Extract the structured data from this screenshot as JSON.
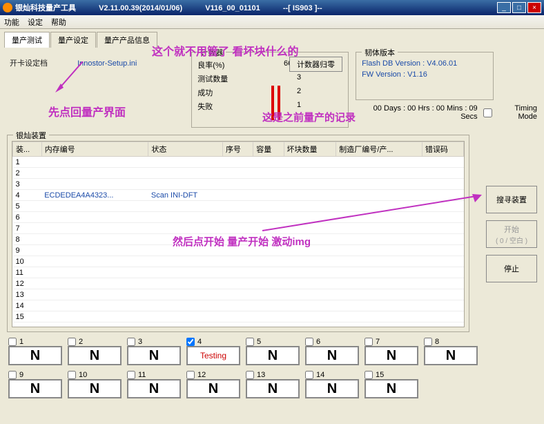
{
  "window": {
    "title1": "银灿科技量产工具",
    "title2": "V2.11.00.39(2014/01/06)",
    "title3": "V116_00_01101",
    "title4": "--[ IS903 ]--"
  },
  "menu": {
    "func": "功能",
    "settings": "设定",
    "help": "帮助"
  },
  "tabs": {
    "t1": "量产测试",
    "t2": "量产设定",
    "t3": "量产产品信息"
  },
  "opencard": {
    "label": "开卡设定档",
    "file": "Innostor-Setup.ini"
  },
  "counter": {
    "title": "计数器",
    "reset": "计数器归零",
    "rows": [
      {
        "label": "良率(%)",
        "value": "66 %"
      },
      {
        "label": "测试数量",
        "value": "3"
      },
      {
        "label": "成功",
        "value": "2"
      },
      {
        "label": "失败",
        "value": "1"
      }
    ]
  },
  "fw": {
    "title": "韧体版本",
    "db": "Flash DB Version :  V4.06.01",
    "ver": "FW Version :  V1.16"
  },
  "timing": {
    "elapsed": "00 Days : 00 Hrs : 00 Mins : 09 Secs",
    "label": "Timing Mode"
  },
  "table": {
    "group_title": "银灿装置",
    "headers": [
      "装...",
      "内存编号",
      "状态",
      "序号",
      "容量",
      "坏块数量",
      "制造厂编号/产...",
      "错误码"
    ],
    "rows": [
      {
        "n": "1"
      },
      {
        "n": "2"
      },
      {
        "n": "3"
      },
      {
        "n": "4",
        "mem": "ECDEDEA4A4323...",
        "status": "Scan INI-DFT"
      },
      {
        "n": "5"
      },
      {
        "n": "6"
      },
      {
        "n": "7"
      },
      {
        "n": "8"
      },
      {
        "n": "9"
      },
      {
        "n": "10"
      },
      {
        "n": "11"
      },
      {
        "n": "12"
      },
      {
        "n": "13"
      },
      {
        "n": "14"
      },
      {
        "n": "15"
      }
    ]
  },
  "buttons": {
    "search": "搜寻装置",
    "start": "开始",
    "start_sub": "( 0 / 空白 )",
    "stop": "停止"
  },
  "ports": [
    {
      "n": "1",
      "txt": "N"
    },
    {
      "n": "2",
      "txt": "N"
    },
    {
      "n": "3",
      "txt": "N"
    },
    {
      "n": "4",
      "txt": "Testing",
      "checked": true,
      "testing": true
    },
    {
      "n": "5",
      "txt": "N"
    },
    {
      "n": "6",
      "txt": "N"
    },
    {
      "n": "7",
      "txt": "N"
    },
    {
      "n": "8",
      "txt": "N"
    },
    {
      "n": "9",
      "txt": "N"
    },
    {
      "n": "10",
      "txt": "N"
    },
    {
      "n": "11",
      "txt": "N"
    },
    {
      "n": "12",
      "txt": "N"
    },
    {
      "n": "13",
      "txt": "N"
    },
    {
      "n": "14",
      "txt": "N"
    },
    {
      "n": "15",
      "txt": "N"
    }
  ],
  "annotations": {
    "a1": "这个就不用管了 看坏块什么的",
    "a2": "先点回量产界面",
    "a3": "这是之前量产的记录",
    "a4": "然后点开始  量产开始 激动img"
  }
}
